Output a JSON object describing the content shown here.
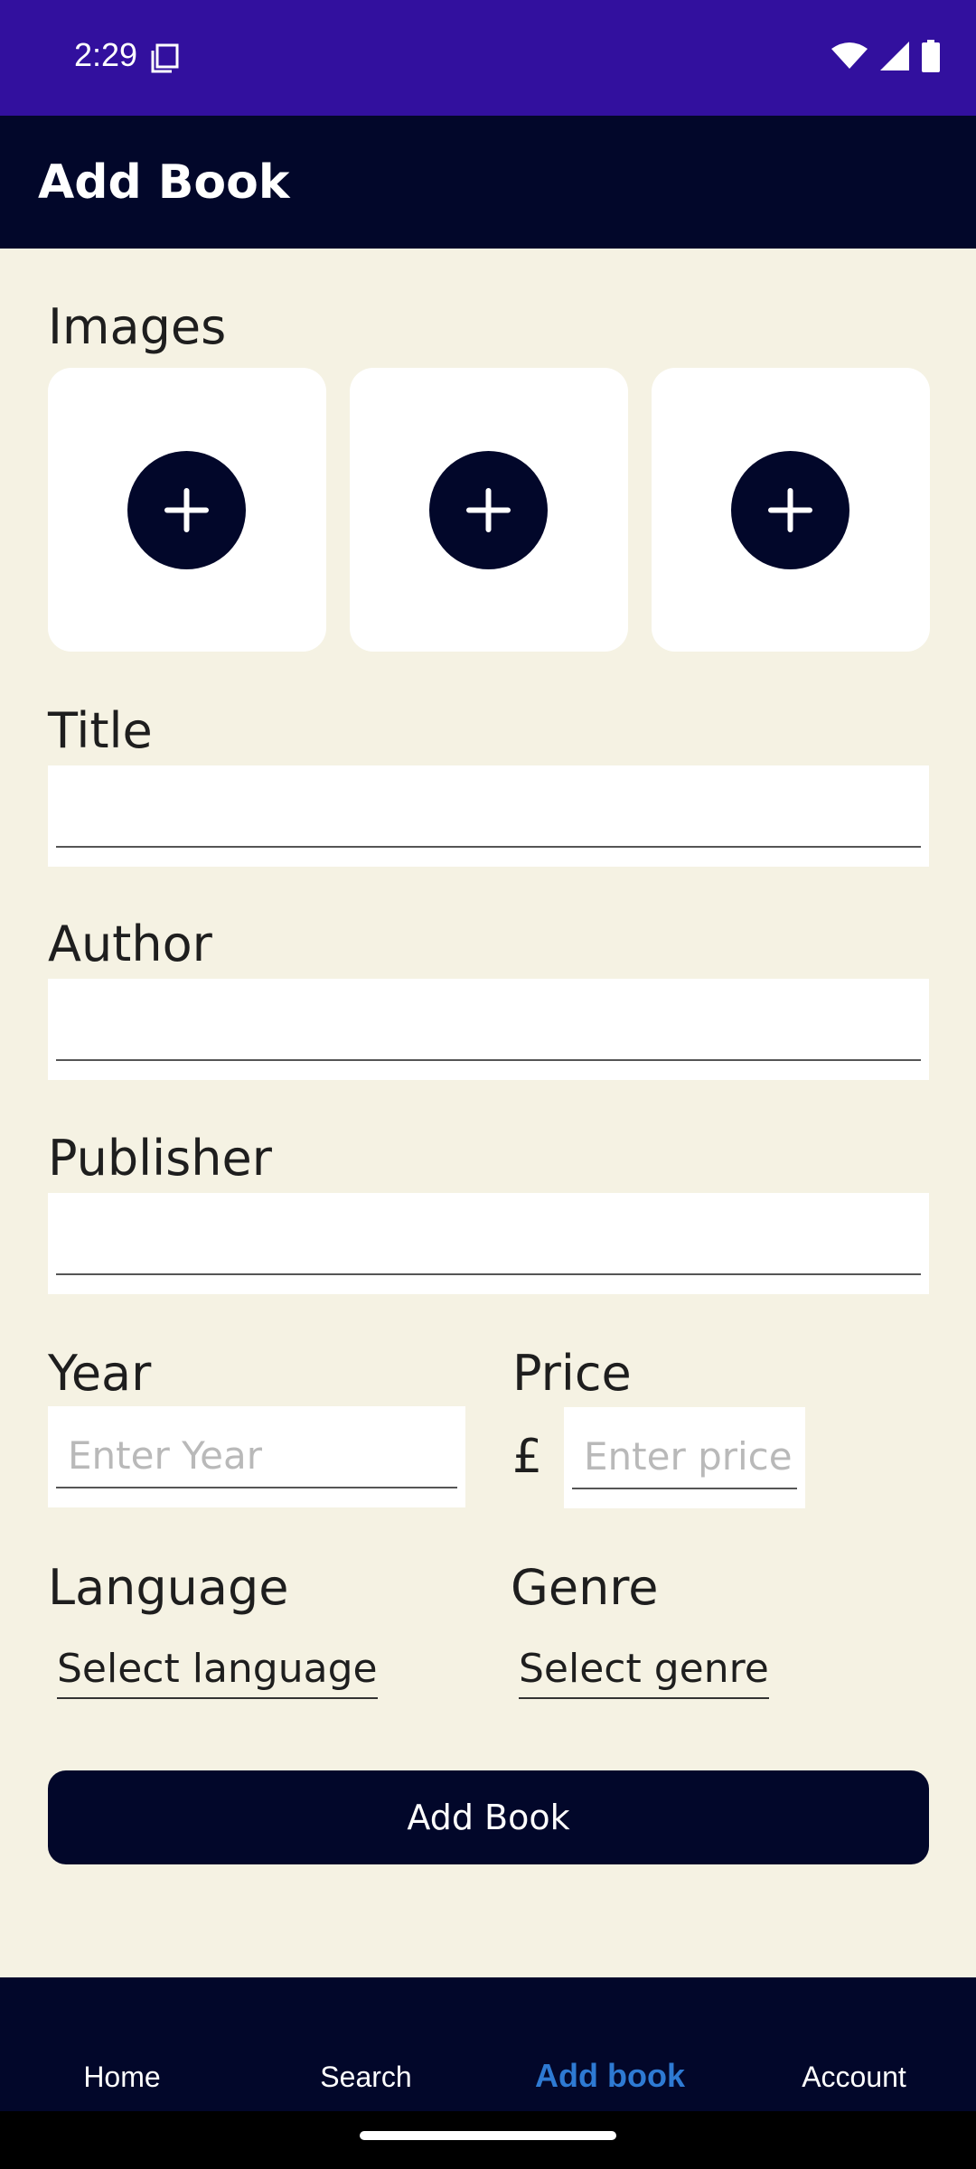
{
  "status_bar": {
    "time": "2:29",
    "icons": [
      "screenshot-icon",
      "wifi-icon",
      "signal-icon",
      "battery-icon"
    ]
  },
  "app_bar": {
    "title": "Add Book"
  },
  "form": {
    "images_label": "Images",
    "image_slots": [
      "add-image",
      "add-image",
      "add-image"
    ],
    "title_label": "Title",
    "title_value": "",
    "author_label": "Author",
    "author_value": "",
    "publisher_label": "Publisher",
    "publisher_value": "",
    "year_label": "Year",
    "year_placeholder": "Enter Year",
    "price_label": "Price",
    "currency_symbol": "£",
    "price_placeholder": "Enter price",
    "language_label": "Language",
    "language_selected": "Select language",
    "genre_label": "Genre",
    "genre_selected": "Select genre",
    "submit_label": "Add Book"
  },
  "bottom_nav": {
    "items": [
      {
        "label": "Home",
        "active": false
      },
      {
        "label": "Search",
        "active": false
      },
      {
        "label": "Add book",
        "active": true
      },
      {
        "label": "Account",
        "active": false
      }
    ]
  },
  "colors": {
    "status_bar": "#32109E",
    "app_bar": "#02072A",
    "background": "#F5F2E3",
    "accent": "#2E7AD3"
  }
}
